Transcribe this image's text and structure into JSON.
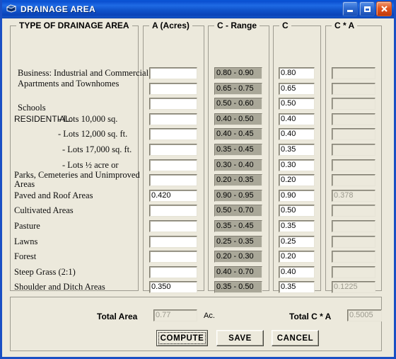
{
  "window": {
    "title": "DRAINAGE AREA",
    "icon": "drainage-window-icon",
    "minimize_label": "Minimize",
    "maximize_label": "Maximize",
    "close_label": "Close",
    "accent_color": "#1155cd",
    "client_bg": "#ece9dc"
  },
  "groups": {
    "type": "TYPE OF DRAINAGE AREA",
    "a_acres": "A (Acres)",
    "c_range": "C - Range",
    "c": "C",
    "ca": "C * A"
  },
  "labels": {
    "residential": "RESIDENTIAL:"
  },
  "rows": [
    {
      "label": "Business: Industrial and Commercial",
      "label2": "",
      "a": "",
      "c_range": "0.80 - 0.90",
      "c": "0.80",
      "ca": ""
    },
    {
      "label": "Apartments and Townhomes",
      "label2": "",
      "a": "",
      "c_range": "0.65 - 0.75",
      "c": "0.65",
      "ca": ""
    },
    {
      "label": "Schools",
      "label2": "",
      "a": "",
      "c_range": "0.50 - 0.60",
      "c": "0.50",
      "ca": ""
    },
    {
      "label": "- Lots 10,000 sq.",
      "label2": "",
      "a": "",
      "c_range": "0.40 - 0.50",
      "c": "0.40",
      "ca": ""
    },
    {
      "label": "- Lots 12,000 sq. ft.",
      "label2": "",
      "a": "",
      "c_range": "0.40 - 0.45",
      "c": "0.40",
      "ca": ""
    },
    {
      "label": "- Lots 17,000 sq. ft.",
      "label2": "",
      "a": "",
      "c_range": "0.35 - 0.45",
      "c": "0.35",
      "ca": ""
    },
    {
      "label": "- Lots ½ acre or",
      "label2": "",
      "a": "",
      "c_range": "0.30 - 0.40",
      "c": "0.30",
      "ca": ""
    },
    {
      "label": "Parks, Cemeteries and Unimproved",
      "label2": "Areas",
      "a": "",
      "c_range": "0.20 - 0.35",
      "c": "0.20",
      "ca": ""
    },
    {
      "label": "Paved and Roof Areas",
      "label2": "",
      "a": "0.420",
      "c_range": "0.90 - 0.95",
      "c": "0.90",
      "ca": "0.378"
    },
    {
      "label": "Cultivated Areas",
      "label2": "",
      "a": "",
      "c_range": "0.50 - 0.70",
      "c": "0.50",
      "ca": ""
    },
    {
      "label": "Pasture",
      "label2": "",
      "a": "",
      "c_range": "0.35 - 0.45",
      "c": "0.35",
      "ca": ""
    },
    {
      "label": "Lawns",
      "label2": "",
      "a": "",
      "c_range": "0.25 - 0.35",
      "c": "0.25",
      "ca": ""
    },
    {
      "label": "Forest",
      "label2": "",
      "a": "",
      "c_range": "0.20 - 0.30",
      "c": "0.20",
      "ca": ""
    },
    {
      "label": "Steep Grass (2:1)",
      "label2": "",
      "a": "",
      "c_range": "0.40 - 0.70",
      "c": "0.40",
      "ca": ""
    },
    {
      "label": "Shoulder and Ditch Areas",
      "label2": "",
      "a": "0.350",
      "c_range": "0.35 - 0.50",
      "c": "0.35",
      "ca": "0.1225"
    }
  ],
  "totals": {
    "area_label": "Total Area",
    "area_value": "0.77",
    "area_unit": "Ac.",
    "ca_label": "Total C * A",
    "ca_value": "0.5005"
  },
  "buttons": {
    "compute": "COMPUTE",
    "save": "SAVE",
    "cancel": "CANCEL"
  }
}
